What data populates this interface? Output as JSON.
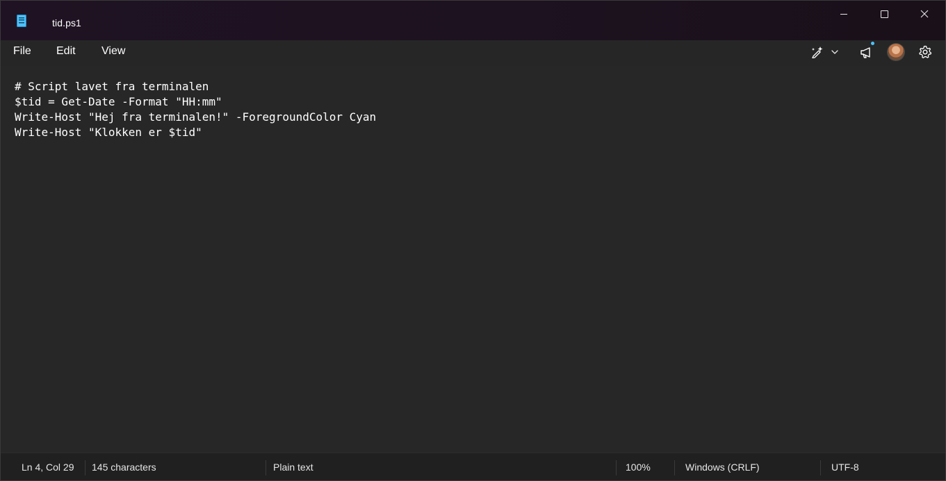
{
  "window": {
    "tab_title": "tid.ps1"
  },
  "menu": {
    "file": "File",
    "edit": "Edit",
    "view": "View"
  },
  "toolbar": {
    "copilot_icon": "copilot-pen-sparkle-icon",
    "dropdown_icon": "chevron-down-icon",
    "announce_icon": "megaphone-icon",
    "settings_icon": "gear-icon"
  },
  "editor": {
    "lines": [
      "# Script lavet fra terminalen",
      "$tid = Get-Date -Format \"HH:mm\"",
      "Write-Host \"Hej fra terminalen!\" -ForegroundColor Cyan",
      "Write-Host \"Klokken er $tid\""
    ]
  },
  "status": {
    "position": "Ln 4, Col 29",
    "characters": "145 characters",
    "format": "Plain text",
    "zoom": "100%",
    "line_ending": "Windows (CRLF)",
    "encoding": "UTF-8"
  },
  "colors": {
    "accent": "#4cc2ff",
    "titlebar": "#1f1323",
    "editor_bg": "#272727",
    "statusbar_bg": "#202020"
  }
}
